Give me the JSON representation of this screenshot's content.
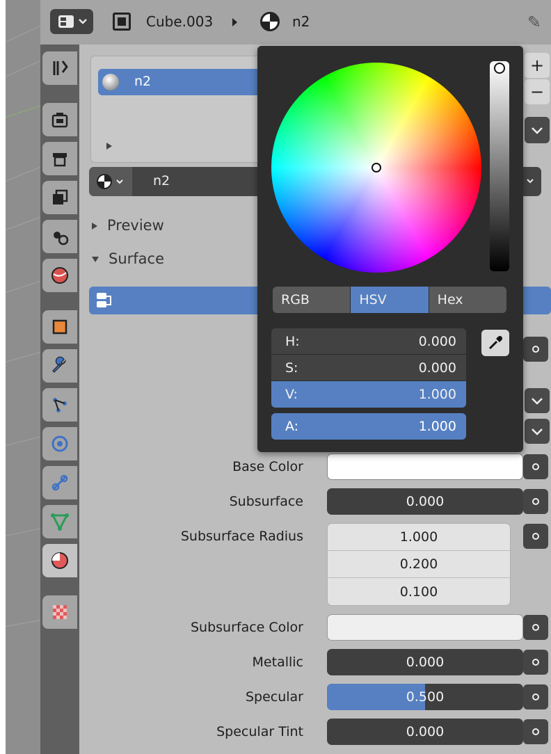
{
  "header": {
    "object_name": "Cube.003",
    "material_name": "n2"
  },
  "tabs": [
    {
      "id": "tool",
      "icon": "tool-icon"
    },
    {
      "id": "render",
      "icon": "render-icon"
    },
    {
      "id": "output",
      "icon": "output-icon"
    },
    {
      "id": "view-layer",
      "icon": "view-layer-icon"
    },
    {
      "id": "scene",
      "icon": "scene-icon"
    },
    {
      "id": "world",
      "icon": "world-icon"
    },
    {
      "id": "object",
      "icon": "object-icon"
    },
    {
      "id": "modifiers",
      "icon": "wrench-icon"
    },
    {
      "id": "particles",
      "icon": "particles-icon"
    },
    {
      "id": "physics",
      "icon": "physics-icon"
    },
    {
      "id": "constraints",
      "icon": "constraint-icon"
    },
    {
      "id": "object-data",
      "icon": "mesh-data-icon"
    },
    {
      "id": "material",
      "icon": "material-icon",
      "active": true
    },
    {
      "id": "texture",
      "icon": "texture-icon"
    }
  ],
  "material_slots": {
    "items": [
      {
        "name": "n2"
      }
    ],
    "add_label": "+",
    "remove_label": "−"
  },
  "material_select": {
    "name": "n2"
  },
  "panels": {
    "preview_label": "Preview",
    "surface_label": "Surface"
  },
  "properties": {
    "base_color": {
      "label": "Base Color",
      "color": "#ffffff"
    },
    "subsurface": {
      "label": "Subsurface",
      "value": "0.000"
    },
    "subsurface_radius": {
      "label": "Subsurface Radius",
      "values": [
        "1.000",
        "0.200",
        "0.100"
      ]
    },
    "subsurface_color": {
      "label": "Subsurface Color",
      "color": "#efefef"
    },
    "metallic": {
      "label": "Metallic",
      "value": "0.000"
    },
    "specular": {
      "label": "Specular",
      "value": "0.500",
      "fraction": 0.5
    },
    "specular_tint": {
      "label": "Specular Tint",
      "value": "0.000"
    }
  },
  "color_picker": {
    "modes": [
      "RGB",
      "HSV",
      "Hex"
    ],
    "active_mode": "HSV",
    "channels": [
      {
        "label": "H:",
        "value": "0.000"
      },
      {
        "label": "S:",
        "value": "0.000"
      },
      {
        "label": "V:",
        "value": "1.000",
        "highlighted": true
      }
    ],
    "alpha": {
      "label": "A:",
      "value": "1.000"
    }
  },
  "colors": {
    "accent": "#5680c2",
    "panel_bg": "#bdbdbd",
    "popup_bg": "#2d2d2d",
    "field_dark": "#3f3f3f"
  }
}
